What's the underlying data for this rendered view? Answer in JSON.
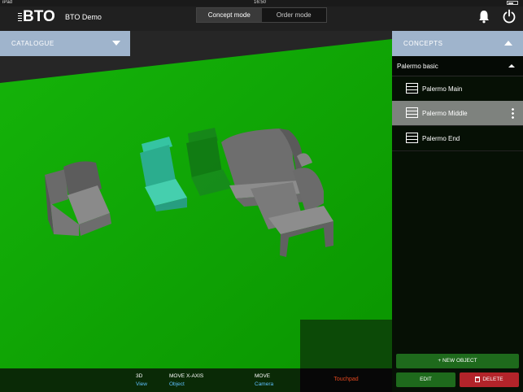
{
  "statusbar": {
    "carrier": "iPad",
    "time": "16:50"
  },
  "header": {
    "logo": "BTO",
    "app_title": "BTO Demo",
    "modes": [
      {
        "label": "Concept mode",
        "active": true
      },
      {
        "label": "Order mode",
        "active": false
      }
    ]
  },
  "catalogue": {
    "label": "CATALOGUE"
  },
  "bottombar": {
    "items": [
      {
        "title": "3D",
        "sub": "View"
      },
      {
        "title": "MOVE X-AXIS",
        "sub": "Object"
      },
      {
        "title": "MOVE",
        "sub": "Camera"
      }
    ],
    "touchpad": "Touchpad"
  },
  "concepts": {
    "header": "CONCEPTS",
    "group": "Palermo basic",
    "items": [
      {
        "label": "Palermo Main",
        "selected": false
      },
      {
        "label": "Palermo Middle",
        "selected": true
      },
      {
        "label": "Palermo End",
        "selected": false
      }
    ]
  },
  "actions": {
    "new_object": "+ NEW OBJECT",
    "edit": "EDIT",
    "delete": "DELETE"
  },
  "colors": {
    "floor": "#0ea300",
    "accent_bar": "#9fb4cc",
    "edit_green": "#1e6a1c",
    "delete_red": "#b3242a",
    "touchpad_text": "#e0471f",
    "link_blue": "#5ec0ff"
  },
  "icons": [
    "bell-icon",
    "power-icon",
    "chevron-down-icon",
    "chevron-up-icon",
    "list-icon",
    "more-vertical-icon",
    "trash-icon"
  ]
}
